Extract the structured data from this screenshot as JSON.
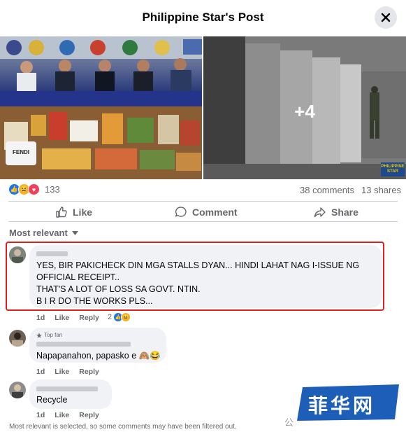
{
  "header": {
    "title": "Philippine Star's Post"
  },
  "post": {
    "more_photos": "+4",
    "photo_badge": "PHILIPPINE STAR",
    "poster_brand": "FENDI"
  },
  "stats": {
    "reaction_count": "133",
    "comments": "38 comments",
    "shares": "13 shares"
  },
  "actions": {
    "like": "Like",
    "comment": "Comment",
    "share": "Share"
  },
  "sort": {
    "label": "Most relevant"
  },
  "comments": [
    {
      "lines": [
        "YES, BIR PAKICHECK DIN MGA STALLS DYAN... HINDI LAHAT NAG I-ISSUE NG",
        "OFFICIAL RECEIPT..",
        "THAT'S A LOT OF LOSS SA GOVT. NTIN.",
        "B I R DO THE WORKS PLS..."
      ],
      "time": "1d",
      "like": "Like",
      "reply": "Reply",
      "reaction_count": "2"
    },
    {
      "badge": "Top fan",
      "text": "Napapanahon, papasko e 🙈😂",
      "time": "1d",
      "like": "Like",
      "reply": "Reply"
    },
    {
      "text": "Recycle",
      "time": "1d",
      "like": "Like",
      "reply": "Reply"
    }
  ],
  "footer": {
    "note": "Most relevant is selected, so some comments may have been filtered out."
  },
  "watermark": {
    "text": "菲华网",
    "prefix": "公"
  },
  "colors": {
    "highlight": "#e02020",
    "like_blue": "#1877f2",
    "love_red": "#f33e58",
    "haha_yellow": "#f7b125",
    "watermark_blue": "#1d5fb8"
  }
}
